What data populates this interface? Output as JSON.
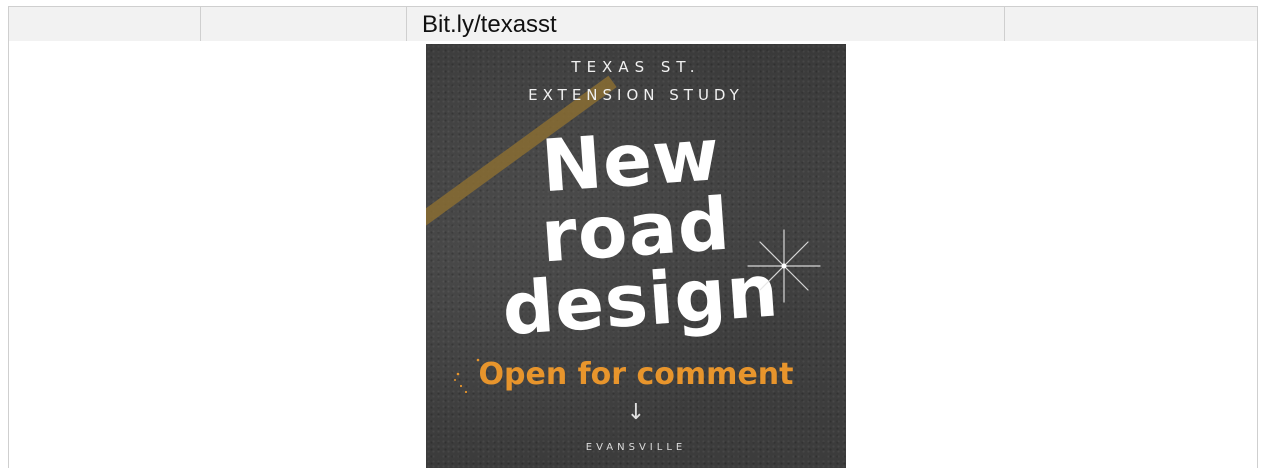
{
  "table": {
    "header_text": "Bit.ly/texasst"
  },
  "poster": {
    "subtitle_line1": "TEXAS ST.",
    "subtitle_line2": "EXTENSION STUDY",
    "headline_line1": "New",
    "headline_line2": "road",
    "headline_line3": "design",
    "call_to_action": "Open for comment",
    "arrow_glyph": "↓",
    "location": "EVANSVILLE",
    "colors": {
      "accent_orange": "#e8952c",
      "asphalt": "#404040",
      "road_line": "#8a6d33"
    },
    "icons": [
      "sparkle-icon",
      "down-arrow-icon"
    ]
  }
}
